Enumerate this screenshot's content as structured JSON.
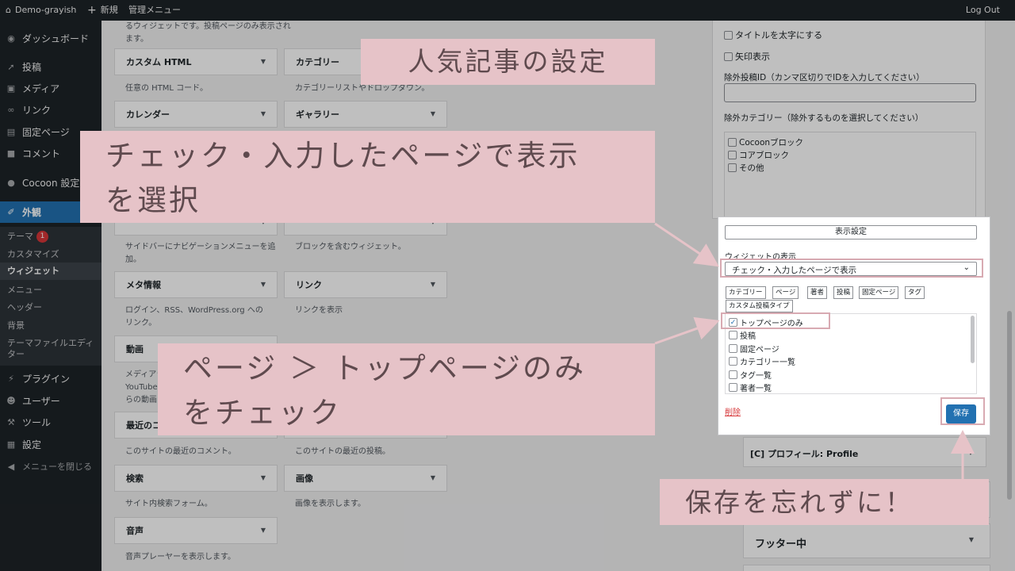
{
  "adminbar": {
    "site_name": "Demo-grayish",
    "new_label": "新規",
    "admin_menu": "管理メニュー",
    "logout": "Log Out"
  },
  "sidebar": {
    "items": [
      {
        "label": "ダッシュボード",
        "icon": "dashboard-icon"
      },
      {
        "label": "投稿",
        "icon": "pin-icon"
      },
      {
        "label": "メディア",
        "icon": "media-icon"
      },
      {
        "label": "リンク",
        "icon": "link-icon"
      },
      {
        "label": "固定ページ",
        "icon": "page-icon"
      },
      {
        "label": "コメント",
        "icon": "comment-icon"
      },
      {
        "label": "Cocoon 設定",
        "icon": "cocoon-icon"
      },
      {
        "label": "外観",
        "icon": "brush-icon"
      },
      {
        "label": "プラグイン",
        "icon": "plugin-icon"
      },
      {
        "label": "ユーザー",
        "icon": "user-icon"
      },
      {
        "label": "ツール",
        "icon": "wrench-icon"
      },
      {
        "label": "設定",
        "icon": "settings-icon"
      },
      {
        "label": "メニューを閉じる",
        "icon": "collapse-icon"
      }
    ],
    "submenu": {
      "theme": "テーマ",
      "theme_badge": "1",
      "customize": "カスタマイズ",
      "widgets": "ウィジェット",
      "menus": "メニュー",
      "header": "ヘッダー",
      "background": "背景",
      "theme_editor": "テーマファイルエディター"
    }
  },
  "widgets": {
    "top_desc": "るウィジェットです。投稿ページのみ表示されます。",
    "custom_html": {
      "title": "カスタム HTML",
      "desc": "任意の HTML コード。"
    },
    "category": {
      "title": "カテゴリー",
      "desc": "カテゴリーリストやドロップダウン。"
    },
    "calendar": {
      "title": "カレンダー"
    },
    "gallery": {
      "title": "ギャラリー"
    },
    "nav_desc": "サイドバーにナビゲーションメニューを追加。",
    "block_desc": "ブロックを含むウィジェット。",
    "meta": {
      "title": "メタ情報",
      "desc": "ログイン、RSS、WordPress.org へのリンク。"
    },
    "link": {
      "title": "リンク",
      "desc": "リンクを表示"
    },
    "video": {
      "title": "動画",
      "desc_partial_1": "メディアラ",
      "desc_partial_2": "YouTube",
      "desc_partial_3": "らの動画を"
    },
    "recent_comments": {
      "title": "最近のコ",
      "desc": "このサイトの最近のコメント。"
    },
    "recent_posts_desc": "このサイトの最近の投稿。",
    "search": {
      "title": "検索",
      "desc": "サイト内検索フォーム。"
    },
    "image": {
      "title": "画像",
      "desc": "画像を表示します。"
    },
    "audio": {
      "title": "音声",
      "desc": "音声プレーヤーを表示します。"
    }
  },
  "right_panel": {
    "bold_title": "タイトルを太字にする",
    "arrow_display": "矢印表示",
    "exclude_ids_label": "除外投稿ID（カンマ区切りでIDを入力してください）",
    "exclude_cat_label": "除外カテゴリー（除外するものを選択してください）",
    "categories": [
      "Cocoonブロック",
      "コアブロック",
      "その他"
    ],
    "profile_widget": "[C] プロフィール: Profile",
    "footer_middle": "フッター中"
  },
  "popup": {
    "settings_button": "表示設定",
    "display_label": "ウィジェットの表示",
    "display_select": "チェック・入力したページで表示",
    "tabs": [
      "カテゴリー",
      "ページ",
      "著者",
      "投稿",
      "固定ページ",
      "タグ",
      "カスタム投稿タイプ"
    ],
    "options": [
      {
        "label": "トップページのみ",
        "checked": true
      },
      {
        "label": "投稿",
        "checked": false
      },
      {
        "label": "固定ページ",
        "checked": false
      },
      {
        "label": "カテゴリー一覧",
        "checked": false
      },
      {
        "label": "タグ一覧",
        "checked": false
      },
      {
        "label": "著者一覧",
        "checked": false
      }
    ],
    "delete": "削除",
    "save": "保存"
  },
  "callouts": {
    "title": "人気記事の設定",
    "step1_line1": "チェック・入力したページで表示",
    "step1_line2": "を選択",
    "step2_line1": "ページ ＞ トップページのみ",
    "step2_line2": "をチェック",
    "step3": "保存を忘れずに！"
  },
  "colors": {
    "accent": "#2271b1",
    "callout_bg": "#e6c3c8",
    "callout_text": "#5f4a4e",
    "frame": "#d8aab2"
  }
}
